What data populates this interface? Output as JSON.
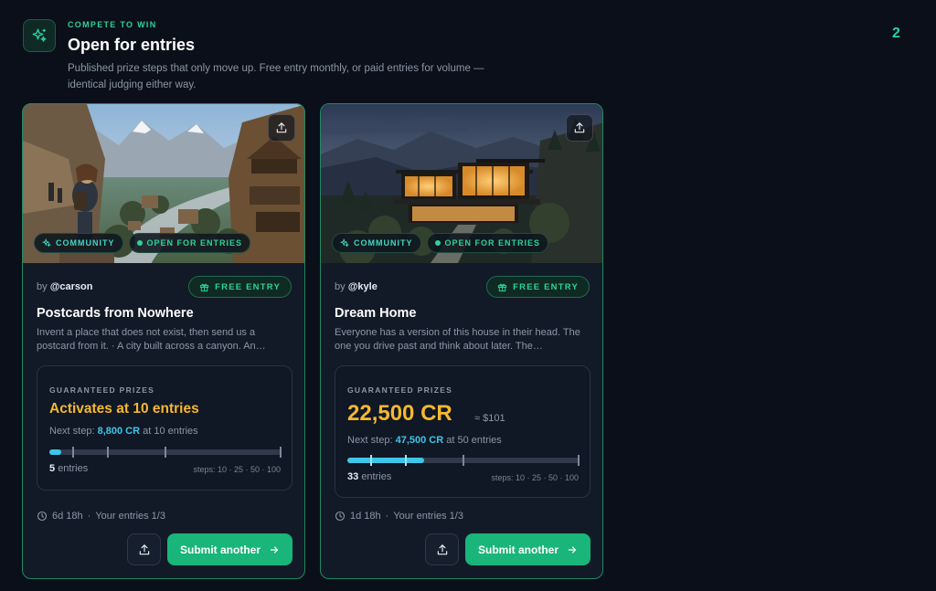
{
  "header": {
    "eyebrow": "COMPETE TO WIN",
    "title": "Open for entries",
    "description": "Published prize steps that only move up. Free entry monthly, or paid entries for volume — identical judging either way.",
    "count": "2",
    "icon": "sparkles-icon"
  },
  "colors": {
    "accent": "#2bd39a",
    "prize": "#f5b82e",
    "progress": "#3ec6e8",
    "submit_button": "#19b57a"
  },
  "contests": [
    {
      "category_tag": "COMMUNITY",
      "status_tag": "OPEN FOR ENTRIES",
      "by_prefix": "by",
      "author": "@carson",
      "entry_badge": "FREE ENTRY",
      "title": "Postcards from Nowhere",
      "description": "Invent a place that does not exist, then send us a postcard from it. · A city built across a canyon. An…",
      "prize_label": "GUARANTEED PRIZES",
      "prize_headline": "Activates at 10 entries",
      "next_step_prefix": "Next step:",
      "next_step_amount": "8,800 CR",
      "next_step_suffix": "at 10 entries",
      "entries_count": "5",
      "entries_label": "entries",
      "steps_text": "steps: 10 · 25 · 50 · 100",
      "progress_fraction": 0.05,
      "time_left": "6d 18h",
      "your_entries": "Your entries 1/3",
      "submit_label": "Submit another"
    },
    {
      "category_tag": "COMMUNITY",
      "status_tag": "OPEN FOR ENTRIES",
      "by_prefix": "by",
      "author": "@kyle",
      "entry_badge": "FREE ENTRY",
      "title": "Dream Home",
      "description": "Everyone has a version of this house in their head. The one you drive past and think about later. The…",
      "prize_label": "GUARANTEED PRIZES",
      "prize_amount": "22,500 CR",
      "prize_usd": "≈ $101",
      "next_step_prefix": "Next step:",
      "next_step_amount": "47,500 CR",
      "next_step_suffix": "at 50 entries",
      "entries_count": "33",
      "entries_label": "entries",
      "steps_text": "steps: 10 · 25 · 50 · 100",
      "progress_fraction": 0.33,
      "time_left": "1d 18h",
      "your_entries": "Your entries 1/3",
      "submit_label": "Submit another"
    }
  ]
}
